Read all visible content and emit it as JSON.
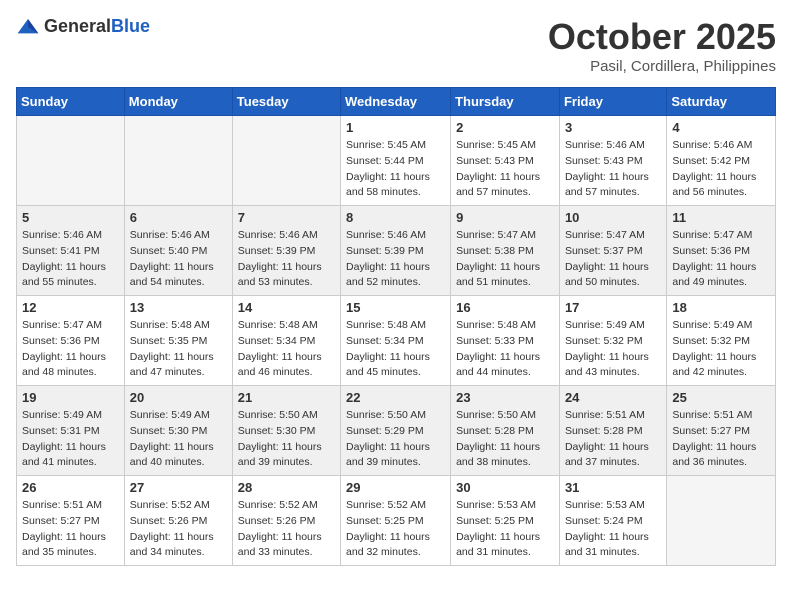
{
  "header": {
    "logo_general": "General",
    "logo_blue": "Blue",
    "month_title": "October 2025",
    "location": "Pasil, Cordillera, Philippines"
  },
  "days_of_week": [
    "Sunday",
    "Monday",
    "Tuesday",
    "Wednesday",
    "Thursday",
    "Friday",
    "Saturday"
  ],
  "weeks": [
    [
      {
        "day": "",
        "info": ""
      },
      {
        "day": "",
        "info": ""
      },
      {
        "day": "",
        "info": ""
      },
      {
        "day": "1",
        "info": "Sunrise: 5:45 AM\nSunset: 5:44 PM\nDaylight: 11 hours\nand 58 minutes."
      },
      {
        "day": "2",
        "info": "Sunrise: 5:45 AM\nSunset: 5:43 PM\nDaylight: 11 hours\nand 57 minutes."
      },
      {
        "day": "3",
        "info": "Sunrise: 5:46 AM\nSunset: 5:43 PM\nDaylight: 11 hours\nand 57 minutes."
      },
      {
        "day": "4",
        "info": "Sunrise: 5:46 AM\nSunset: 5:42 PM\nDaylight: 11 hours\nand 56 minutes."
      }
    ],
    [
      {
        "day": "5",
        "info": "Sunrise: 5:46 AM\nSunset: 5:41 PM\nDaylight: 11 hours\nand 55 minutes."
      },
      {
        "day": "6",
        "info": "Sunrise: 5:46 AM\nSunset: 5:40 PM\nDaylight: 11 hours\nand 54 minutes."
      },
      {
        "day": "7",
        "info": "Sunrise: 5:46 AM\nSunset: 5:39 PM\nDaylight: 11 hours\nand 53 minutes."
      },
      {
        "day": "8",
        "info": "Sunrise: 5:46 AM\nSunset: 5:39 PM\nDaylight: 11 hours\nand 52 minutes."
      },
      {
        "day": "9",
        "info": "Sunrise: 5:47 AM\nSunset: 5:38 PM\nDaylight: 11 hours\nand 51 minutes."
      },
      {
        "day": "10",
        "info": "Sunrise: 5:47 AM\nSunset: 5:37 PM\nDaylight: 11 hours\nand 50 minutes."
      },
      {
        "day": "11",
        "info": "Sunrise: 5:47 AM\nSunset: 5:36 PM\nDaylight: 11 hours\nand 49 minutes."
      }
    ],
    [
      {
        "day": "12",
        "info": "Sunrise: 5:47 AM\nSunset: 5:36 PM\nDaylight: 11 hours\nand 48 minutes."
      },
      {
        "day": "13",
        "info": "Sunrise: 5:48 AM\nSunset: 5:35 PM\nDaylight: 11 hours\nand 47 minutes."
      },
      {
        "day": "14",
        "info": "Sunrise: 5:48 AM\nSunset: 5:34 PM\nDaylight: 11 hours\nand 46 minutes."
      },
      {
        "day": "15",
        "info": "Sunrise: 5:48 AM\nSunset: 5:34 PM\nDaylight: 11 hours\nand 45 minutes."
      },
      {
        "day": "16",
        "info": "Sunrise: 5:48 AM\nSunset: 5:33 PM\nDaylight: 11 hours\nand 44 minutes."
      },
      {
        "day": "17",
        "info": "Sunrise: 5:49 AM\nSunset: 5:32 PM\nDaylight: 11 hours\nand 43 minutes."
      },
      {
        "day": "18",
        "info": "Sunrise: 5:49 AM\nSunset: 5:32 PM\nDaylight: 11 hours\nand 42 minutes."
      }
    ],
    [
      {
        "day": "19",
        "info": "Sunrise: 5:49 AM\nSunset: 5:31 PM\nDaylight: 11 hours\nand 41 minutes."
      },
      {
        "day": "20",
        "info": "Sunrise: 5:49 AM\nSunset: 5:30 PM\nDaylight: 11 hours\nand 40 minutes."
      },
      {
        "day": "21",
        "info": "Sunrise: 5:50 AM\nSunset: 5:30 PM\nDaylight: 11 hours\nand 39 minutes."
      },
      {
        "day": "22",
        "info": "Sunrise: 5:50 AM\nSunset: 5:29 PM\nDaylight: 11 hours\nand 39 minutes."
      },
      {
        "day": "23",
        "info": "Sunrise: 5:50 AM\nSunset: 5:28 PM\nDaylight: 11 hours\nand 38 minutes."
      },
      {
        "day": "24",
        "info": "Sunrise: 5:51 AM\nSunset: 5:28 PM\nDaylight: 11 hours\nand 37 minutes."
      },
      {
        "day": "25",
        "info": "Sunrise: 5:51 AM\nSunset: 5:27 PM\nDaylight: 11 hours\nand 36 minutes."
      }
    ],
    [
      {
        "day": "26",
        "info": "Sunrise: 5:51 AM\nSunset: 5:27 PM\nDaylight: 11 hours\nand 35 minutes."
      },
      {
        "day": "27",
        "info": "Sunrise: 5:52 AM\nSunset: 5:26 PM\nDaylight: 11 hours\nand 34 minutes."
      },
      {
        "day": "28",
        "info": "Sunrise: 5:52 AM\nSunset: 5:26 PM\nDaylight: 11 hours\nand 33 minutes."
      },
      {
        "day": "29",
        "info": "Sunrise: 5:52 AM\nSunset: 5:25 PM\nDaylight: 11 hours\nand 32 minutes."
      },
      {
        "day": "30",
        "info": "Sunrise: 5:53 AM\nSunset: 5:25 PM\nDaylight: 11 hours\nand 31 minutes."
      },
      {
        "day": "31",
        "info": "Sunrise: 5:53 AM\nSunset: 5:24 PM\nDaylight: 11 hours\nand 31 minutes."
      },
      {
        "day": "",
        "info": ""
      }
    ]
  ]
}
